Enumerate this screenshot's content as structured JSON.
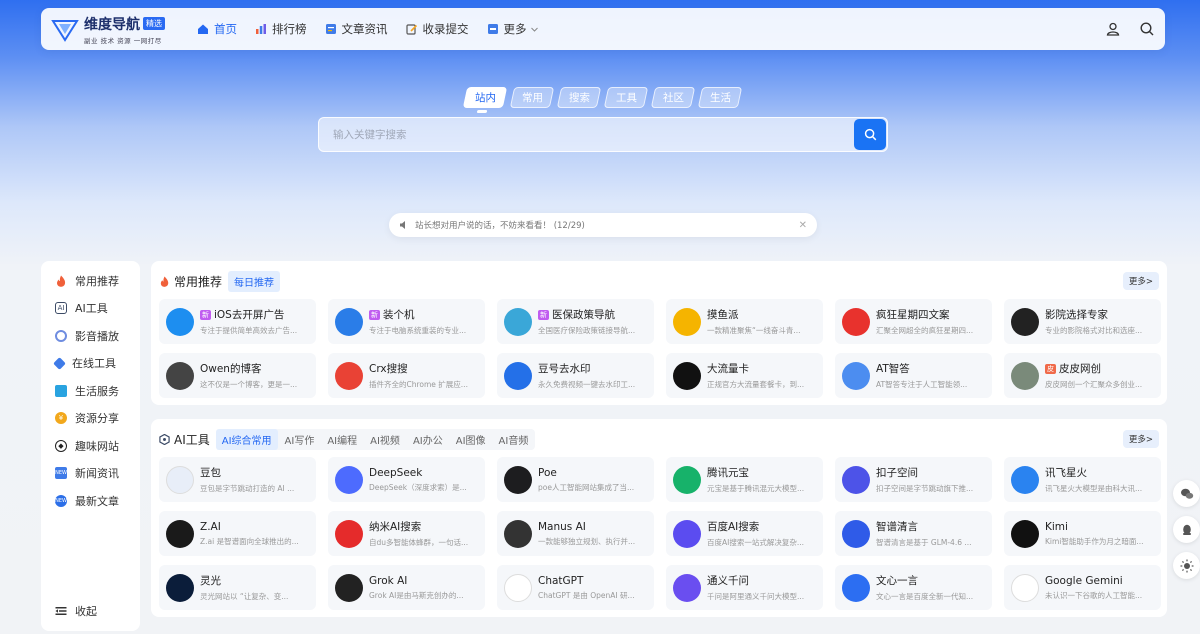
{
  "brand": {
    "name": "维度导航",
    "badge": "精选",
    "tagline": "副业 技术 资源 一网打尽"
  },
  "nav": {
    "items": [
      {
        "label": "首页",
        "icon": "home-icon",
        "active": true
      },
      {
        "label": "排行榜",
        "icon": "chart-icon"
      },
      {
        "label": "文章资讯",
        "icon": "article-icon"
      },
      {
        "label": "收录提交",
        "icon": "edit-icon"
      },
      {
        "label": "更多",
        "icon": "more-icon"
      }
    ]
  },
  "search": {
    "tabs": [
      "站内",
      "常用",
      "搜索",
      "工具",
      "社区",
      "生活"
    ],
    "active_tab": "站内",
    "placeholder": "输入关键字搜索"
  },
  "notice": {
    "text": "站长想对用户说的话，不妨来看看！ (12/29)"
  },
  "sidebar": {
    "items": [
      {
        "label": "常用推荐",
        "icon": "fire-icon",
        "color": "#f0603a"
      },
      {
        "label": "AI工具",
        "icon": "ai-icon",
        "color": "#3c4b66"
      },
      {
        "label": "影音播放",
        "icon": "play-icon",
        "color": "#6f8de0"
      },
      {
        "label": "在线工具",
        "icon": "wrench-icon",
        "color": "#3f7be8"
      },
      {
        "label": "生活服务",
        "icon": "home-icon",
        "color": "#29a3e0"
      },
      {
        "label": "资源分享",
        "icon": "share-icon",
        "color": "#f2a81c"
      },
      {
        "label": "趣味网站",
        "icon": "game-icon",
        "color": "#222"
      },
      {
        "label": "新闻资讯",
        "icon": "news-icon",
        "color": "#3f7be8"
      },
      {
        "label": "最新文章",
        "icon": "new-icon",
        "color": "#2c6fe8"
      }
    ],
    "collapse_label": "收起"
  },
  "recommend": {
    "title": "常用推荐",
    "tab": "每日推荐",
    "more": "更多>",
    "cards": [
      {
        "title": "iOS去开屏广告",
        "desc": "专注于提供简单高效去广告...",
        "badge": "新",
        "icon": "star-icon",
        "color": "#1d8ef0"
      },
      {
        "title": "装个机",
        "desc": "专注于电脑系统重装的专业...",
        "badge": "新",
        "icon": "monitor-icon",
        "color": "#2a7de8"
      },
      {
        "title": "医保政策导航",
        "desc": "全国医疗保险政策链接导航...",
        "badge": "新",
        "icon": "heart-icon",
        "color": "#3aa7d8"
      },
      {
        "title": "摸鱼派",
        "desc": "一款精准聚焦“一线奋斗青...",
        "icon": "fish-icon",
        "color": "#f5b400"
      },
      {
        "title": "疯狂星期四文案",
        "desc": "汇聚全网超全的疯狂星期四...",
        "icon": "fries-icon",
        "color": "#e8322d"
      },
      {
        "title": "影院选择专家",
        "desc": "专业的影院格式对比和选座...",
        "icon": "film-icon",
        "color": "#222"
      },
      {
        "title": "Owen的博客",
        "desc": "这不仅是一个博客，更是一...",
        "icon": "blog-icon",
        "color": "#444"
      },
      {
        "title": "Crx搜搜",
        "desc": "插件齐全的Chrome 扩展应...",
        "icon": "chrome-icon",
        "color": "#e94235"
      },
      {
        "title": "豆号去水印",
        "desc": "永久免费视频一键去水印工...",
        "icon": "fm-icon",
        "color": "#2470e8"
      },
      {
        "title": "大流量卡",
        "desc": "正规官方大流量套餐卡，到...",
        "icon": "card-icon",
        "color": "#111"
      },
      {
        "title": "AT智答",
        "desc": "AT智答专注于人工智能领...",
        "icon": "at-icon",
        "color": "#4c8df0"
      },
      {
        "title": "皮皮网创",
        "desc": "皮皮网创一个汇聚众多创业...",
        "badge2": "皮",
        "icon": "pi-icon",
        "color": "#7a8a7a"
      }
    ]
  },
  "aitools": {
    "title": "AI工具",
    "tabs": [
      "AI综合常用",
      "AI写作",
      "AI编程",
      "AI视频",
      "AI办公",
      "AI图像",
      "AI音频"
    ],
    "active_tab": "AI综合常用",
    "more": "更多>",
    "cards": [
      {
        "title": "豆包",
        "desc": "豆包是字节跳动打造的 AI ...",
        "icon": "doubao-icon",
        "color": "#e8eef8"
      },
      {
        "title": "DeepSeek",
        "desc": "DeepSeek（深度求索）是...",
        "icon": "whale-icon",
        "color": "#4d6bfe"
      },
      {
        "title": "Poe",
        "desc": "poe人工智能网站集成了当...",
        "icon": "poe-icon",
        "color": "#1d1d1f"
      },
      {
        "title": "腾讯元宝",
        "desc": "元宝是基于腾讯混元大模型...",
        "icon": "yuanbao-icon",
        "color": "#17b26a"
      },
      {
        "title": "扣子空间",
        "desc": "扣子空间是字节跳动旗下推...",
        "icon": "coze-icon",
        "color": "#4d53e8"
      },
      {
        "title": "讯飞星火",
        "desc": "讯飞星火大模型是由科大讯...",
        "icon": "spark-icon",
        "color": "#2a83f0"
      },
      {
        "title": "Z.AI",
        "desc": "Z.ai 是智谱面向全球推出的...",
        "icon": "zai-icon",
        "color": "#1a1a1a"
      },
      {
        "title": "纳米AI搜索",
        "desc": "自du多智能体蜂群，一句话...",
        "icon": "nano-icon",
        "color": "#e52b2b"
      },
      {
        "title": "Manus AI",
        "desc": "一款能够独立规划、执行并...",
        "icon": "manus-icon",
        "color": "#333"
      },
      {
        "title": "百度AI搜索",
        "desc": "百度AI搜索一站式解决复杂...",
        "icon": "baidu-ai-icon",
        "color": "#5b4cf0"
      },
      {
        "title": "智谱清言",
        "desc": "智谱清言是基于 GLM-4.6 ...",
        "icon": "zhipu-icon",
        "color": "#2f5be8"
      },
      {
        "title": "Kimi",
        "desc": "Kimi智能助手作为月之暗面...",
        "icon": "kimi-icon",
        "color": "#111"
      },
      {
        "title": "灵光",
        "desc": "灵光网站以 “让复杂、变...",
        "icon": "lingguang-icon",
        "color": "#0b1d3a"
      },
      {
        "title": "Grok AI",
        "desc": "Grok AI是由马斯克创办的...",
        "icon": "grok-icon",
        "color": "#222"
      },
      {
        "title": "ChatGPT",
        "desc": "ChatGPT 是由 OpenAI 研...",
        "icon": "openai-icon",
        "color": "#fff"
      },
      {
        "title": "通义千问",
        "desc": "千问是阿里通义千问大模型...",
        "icon": "qwen-icon",
        "color": "#6a4ef0"
      },
      {
        "title": "文心一言",
        "desc": "文心一言是百度全新一代知...",
        "icon": "wenxin-icon",
        "color": "#2c6ef2"
      },
      {
        "title": "Google Gemini",
        "desc": "未认识一下谷歌的人工智能...",
        "icon": "gemini-icon",
        "color": "#fff"
      }
    ]
  },
  "floating": [
    "wechat-icon",
    "qq-icon",
    "theme-icon"
  ]
}
